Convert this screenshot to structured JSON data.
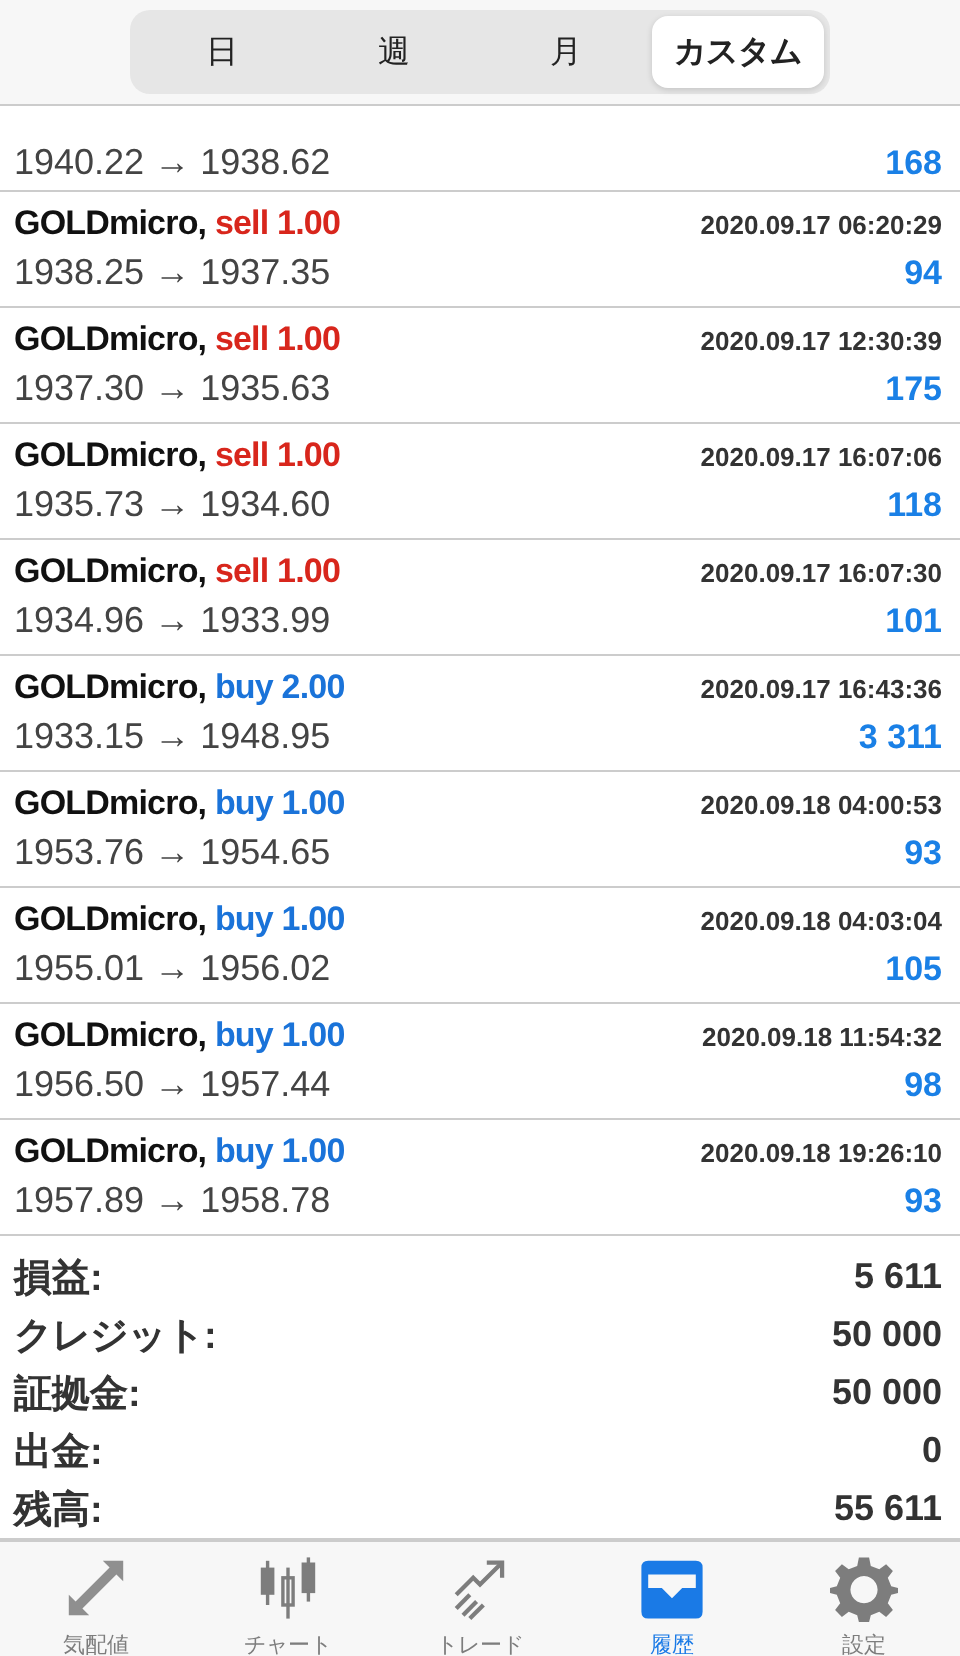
{
  "periods": [
    {
      "label": "日",
      "selected": false
    },
    {
      "label": "週",
      "selected": false
    },
    {
      "label": "月",
      "selected": false
    },
    {
      "label": "カスタム",
      "selected": true
    }
  ],
  "partial_deal": {
    "prices": "1940.22 → 1938.62",
    "profit": "168"
  },
  "deals": [
    {
      "symbol": "GOLDmicro,",
      "kind": "sell",
      "order": "sell 1.00",
      "time": "2020.09.17 06:20:29",
      "prices": "1938.25 → 1937.35",
      "profit": "94"
    },
    {
      "symbol": "GOLDmicro,",
      "kind": "sell",
      "order": "sell 1.00",
      "time": "2020.09.17 12:30:39",
      "prices": "1937.30 → 1935.63",
      "profit": "175"
    },
    {
      "symbol": "GOLDmicro,",
      "kind": "sell",
      "order": "sell 1.00",
      "time": "2020.09.17 16:07:06",
      "prices": "1935.73 → 1934.60",
      "profit": "118"
    },
    {
      "symbol": "GOLDmicro,",
      "kind": "sell",
      "order": "sell 1.00",
      "time": "2020.09.17 16:07:30",
      "prices": "1934.96 → 1933.99",
      "profit": "101"
    },
    {
      "symbol": "GOLDmicro,",
      "kind": "buy",
      "order": "buy 2.00",
      "time": "2020.09.17 16:43:36",
      "prices": "1933.15 → 1948.95",
      "profit": "3 311"
    },
    {
      "symbol": "GOLDmicro,",
      "kind": "buy",
      "order": "buy 1.00",
      "time": "2020.09.18 04:00:53",
      "prices": "1953.76 → 1954.65",
      "profit": "93"
    },
    {
      "symbol": "GOLDmicro,",
      "kind": "buy",
      "order": "buy 1.00",
      "time": "2020.09.18 04:03:04",
      "prices": "1955.01 → 1956.02",
      "profit": "105"
    },
    {
      "symbol": "GOLDmicro,",
      "kind": "buy",
      "order": "buy 1.00",
      "time": "2020.09.18 11:54:32",
      "prices": "1956.50 → 1957.44",
      "profit": "98"
    },
    {
      "symbol": "GOLDmicro,",
      "kind": "buy",
      "order": "buy 1.00",
      "time": "2020.09.18 19:26:10",
      "prices": "1957.89 → 1958.78",
      "profit": "93"
    }
  ],
  "summary": [
    {
      "label": "損益:",
      "value": "5 611"
    },
    {
      "label": "クレジット:",
      "value": "50 000"
    },
    {
      "label": "証拠金:",
      "value": "50 000"
    },
    {
      "label": "出金:",
      "value": "0"
    },
    {
      "label": "残高:",
      "value": "55 611"
    }
  ],
  "tab_bar": [
    {
      "kind": "quotes",
      "label": "気配値",
      "selected": false
    },
    {
      "kind": "chart",
      "label": "チャート",
      "selected": false
    },
    {
      "kind": "trade",
      "label": "トレード",
      "selected": false
    },
    {
      "kind": "history",
      "label": "履歴",
      "selected": true
    },
    {
      "kind": "settings",
      "label": "設定",
      "selected": false
    }
  ]
}
